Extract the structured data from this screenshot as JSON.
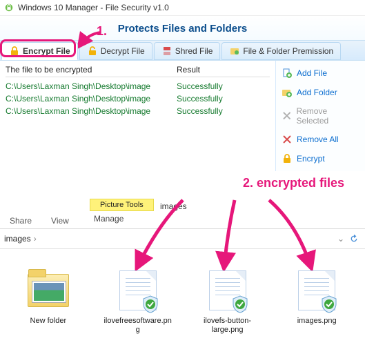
{
  "window": {
    "title": "Windows 10 Manager - File Security v1.0"
  },
  "header": {
    "slogan": "Protects Files and Folders"
  },
  "tabs": {
    "encrypt": "Encrypt File",
    "decrypt": "Decrypt File",
    "shred": "Shred File",
    "permission": "File & Folder Premission"
  },
  "encrypt_list": {
    "col_file": "The file to be encrypted",
    "col_result": "Result",
    "rows": [
      {
        "file": "C:\\Users\\Laxman Singh\\Desktop\\image",
        "result": "Successfully"
      },
      {
        "file": "C:\\Users\\Laxman Singh\\Desktop\\image",
        "result": "Successfully"
      },
      {
        "file": "C:\\Users\\Laxman Singh\\Desktop\\image",
        "result": "Successfully"
      }
    ]
  },
  "side_actions": {
    "add_file": "Add File",
    "add_folder": "Add Folder",
    "remove_selected": "Remove Selected",
    "remove_all": "Remove All",
    "encrypt": "Encrypt"
  },
  "annotations": {
    "step1": "1.",
    "step2": "2. encrypted files"
  },
  "explorer": {
    "ribbon_context": "Picture Tools",
    "ribbon_title": "images",
    "tabs": {
      "share": "Share",
      "view": "View",
      "manage": "Manage"
    },
    "breadcrumb_folder": "images",
    "chevron": "›",
    "items": [
      {
        "label": "New folder"
      },
      {
        "label": "ilovefreesoftware.png"
      },
      {
        "label": "ilovefs-button-large.png"
      },
      {
        "label": "images.png"
      }
    ]
  }
}
